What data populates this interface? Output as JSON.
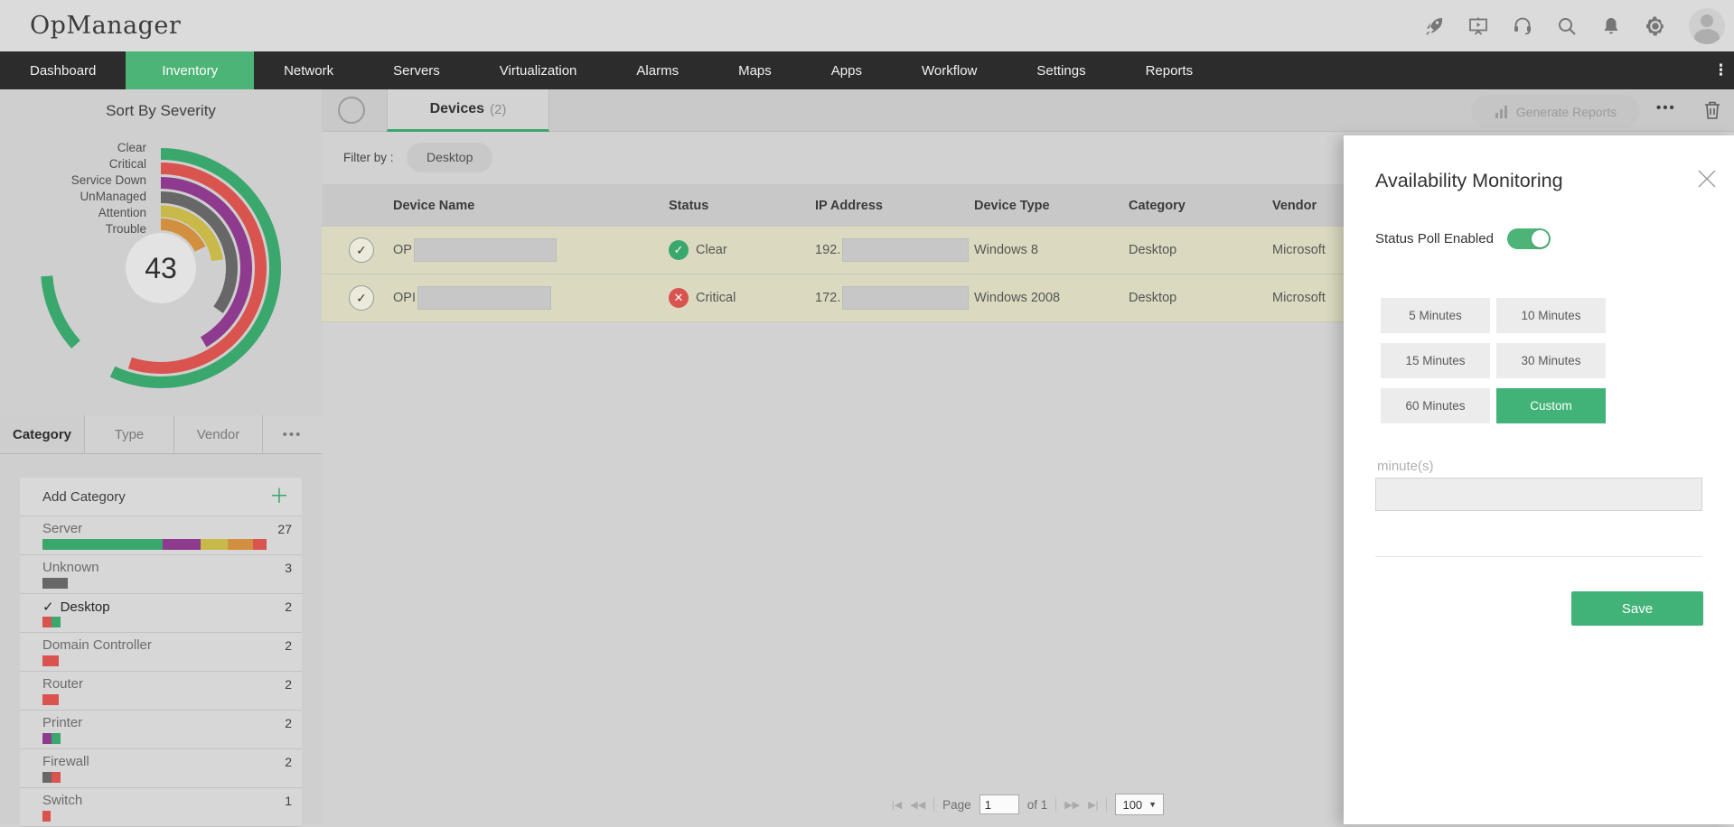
{
  "app": {
    "title": "OpManager"
  },
  "topbar": {
    "icons": [
      "rocket-icon",
      "presentation-icon",
      "headset-icon",
      "search-icon",
      "bell-icon",
      "gear-icon",
      "avatar"
    ]
  },
  "nav": {
    "items": [
      {
        "label": "Dashboard",
        "active": false
      },
      {
        "label": "Inventory",
        "active": true
      },
      {
        "label": "Network",
        "active": false
      },
      {
        "label": "Servers",
        "active": false
      },
      {
        "label": "Virtualization",
        "active": false
      },
      {
        "label": "Alarms",
        "active": false
      },
      {
        "label": "Maps",
        "active": false
      },
      {
        "label": "Apps",
        "active": false
      },
      {
        "label": "Workflow",
        "active": false
      },
      {
        "label": "Settings",
        "active": false
      },
      {
        "label": "Reports",
        "active": false
      }
    ]
  },
  "sidebar": {
    "severity": {
      "title": "Sort By Severity",
      "total": "43",
      "legend": [
        "Clear",
        "Critical",
        "Service Down",
        "UnManaged",
        "Attention",
        "Trouble"
      ],
      "arcs": [
        {
          "label": "Clear",
          "color": "#3aa76d",
          "radius": 126.5,
          "segments": [
            [
              0,
              205
            ],
            [
              228,
              266
            ]
          ]
        },
        {
          "label": "Critical",
          "color": "#d9534f",
          "radius": 110.5,
          "segments": [
            [
              0,
              198
            ]
          ]
        },
        {
          "label": "Service Down",
          "color": "#8e3a8e",
          "radius": 94.5,
          "segments": [
            [
              0,
              150
            ]
          ]
        },
        {
          "label": "UnManaged",
          "color": "#676767",
          "radius": 78.5,
          "segments": [
            [
              0,
              126
            ]
          ]
        },
        {
          "label": "Attention",
          "color": "#c9b949",
          "radius": 63,
          "segments": [
            [
              0,
              82
            ]
          ]
        },
        {
          "label": "Trouble",
          "color": "#d28f3f",
          "radius": 48.5,
          "segments": [
            [
              0,
              64
            ]
          ]
        }
      ]
    },
    "tabs": [
      {
        "label": "Category",
        "active": true
      },
      {
        "label": "Type",
        "active": false
      },
      {
        "label": "Vendor",
        "active": false
      },
      {
        "label": "•••",
        "active": false
      }
    ],
    "add_category_label": "Add Category",
    "categories": [
      {
        "name": "Server",
        "count": "27",
        "checked": false,
        "segments": [
          [
            "#3aa76d",
            133
          ],
          [
            "#8e3a8e",
            42
          ],
          [
            "#c9b949",
            30
          ],
          [
            "#d28f3f",
            28
          ],
          [
            "#d9534f",
            15
          ]
        ]
      },
      {
        "name": "Unknown",
        "count": "3",
        "checked": false,
        "segments": [
          [
            "#676767",
            28
          ]
        ]
      },
      {
        "name": "Desktop",
        "count": "2",
        "checked": true,
        "segments": [
          [
            "#d9534f",
            10
          ],
          [
            "#3aa76d",
            10
          ]
        ]
      },
      {
        "name": "Domain Controller",
        "count": "2",
        "checked": false,
        "segments": [
          [
            "#d9534f",
            18
          ]
        ]
      },
      {
        "name": "Router",
        "count": "2",
        "checked": false,
        "segments": [
          [
            "#d9534f",
            18
          ]
        ]
      },
      {
        "name": "Printer",
        "count": "2",
        "checked": false,
        "segments": [
          [
            "#8e3a8e",
            10
          ],
          [
            "#3aa76d",
            10
          ]
        ]
      },
      {
        "name": "Firewall",
        "count": "2",
        "checked": false,
        "segments": [
          [
            "#676767",
            10
          ],
          [
            "#d9534f",
            10
          ]
        ]
      },
      {
        "name": "Switch",
        "count": "1",
        "checked": false,
        "segments": [
          [
            "#d9534f",
            9
          ]
        ]
      }
    ]
  },
  "main": {
    "tab": {
      "label": "Devices",
      "count": "(2)"
    },
    "toolbar": {
      "generate_reports": "Generate Reports",
      "more_icon": "•••"
    },
    "filter": {
      "label": "Filter by :",
      "chip": "Desktop"
    },
    "table": {
      "headers": [
        "Device Name",
        "Status",
        "IP Address",
        "Device Type",
        "Category",
        "Vendor"
      ],
      "rows": [
        {
          "name_prefix": "OP",
          "status": "Clear",
          "status_type": "clear",
          "status_glyph": "✓",
          "ip_prefix": "192.",
          "device_type": "Windows 8",
          "category": "Desktop",
          "vendor": "Microsoft"
        },
        {
          "name_prefix": "OPI",
          "status": "Critical",
          "status_type": "critical",
          "status_glyph": "✕",
          "ip_prefix": "172.",
          "device_type": "Windows 2008",
          "category": "Desktop",
          "vendor": "Microsoft"
        }
      ]
    },
    "pagination": {
      "first": "|◀",
      "prev": "◀◀",
      "page_label": "Page",
      "page_value": "1",
      "of_label": "of 1",
      "next": "▶▶",
      "last": "▶|",
      "page_size": "100",
      "dropdown": "▼"
    }
  },
  "panel": {
    "title": "Availability Monitoring",
    "toggle_label": "Status Poll Enabled",
    "toggle_on": true,
    "intervals": [
      {
        "label": "5 Minutes",
        "selected": false
      },
      {
        "label": "10 Minutes",
        "selected": false
      },
      {
        "label": "15 Minutes",
        "selected": false
      },
      {
        "label": "30 Minutes",
        "selected": false
      },
      {
        "label": "60 Minutes",
        "selected": false
      },
      {
        "label": "Custom",
        "selected": true
      }
    ],
    "input_label": "minute(s)",
    "input_value": "",
    "save_label": "Save"
  },
  "colors": {
    "accent_green": "#42b378",
    "nav_green": "#4cb475",
    "critical_red": "#d9534f",
    "clear_green": "#3aa76d",
    "row_beige": "#dbdac0",
    "nav_dark": "#2d2c2c"
  }
}
